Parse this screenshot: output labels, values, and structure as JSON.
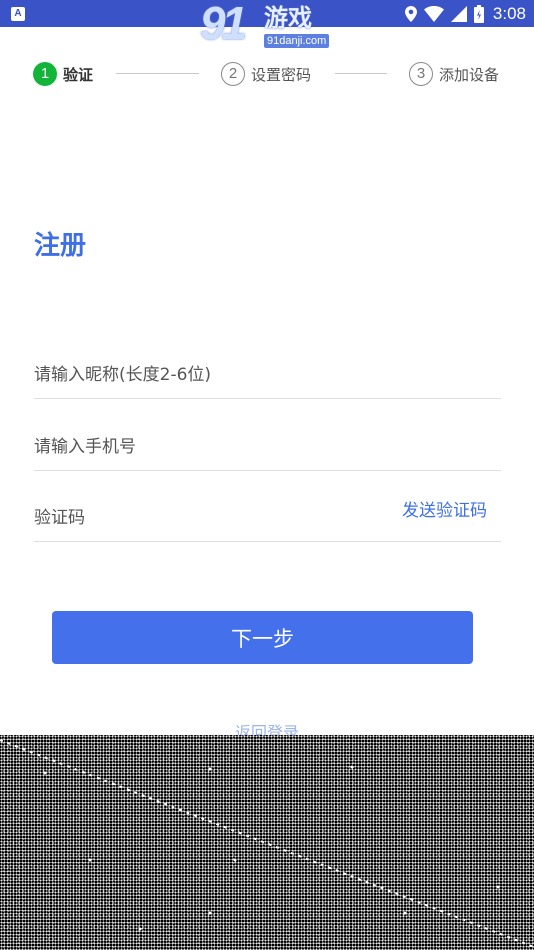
{
  "status_bar": {
    "left_icon": "A",
    "time": "3:08",
    "icons": [
      "location-icon",
      "wifi-icon",
      "signal-icon",
      "battery-icon"
    ]
  },
  "watermark": {
    "digits": "91",
    "name": "游戏",
    "url": "91danji.com"
  },
  "steps": [
    {
      "number": "1",
      "label": "验证",
      "active": true
    },
    {
      "number": "2",
      "label": "设置密码",
      "active": false
    },
    {
      "number": "3",
      "label": "添加设备",
      "active": false
    }
  ],
  "title": "注册",
  "fields": {
    "nickname": {
      "placeholder": "请输入昵称(长度2-6位)",
      "value": ""
    },
    "phone": {
      "placeholder": "请输入手机号",
      "value": ""
    },
    "code": {
      "placeholder": "验证码",
      "value": ""
    }
  },
  "send_code_label": "发送验证码",
  "next_label": "下一步",
  "back_login_label": "返回登录",
  "colors": {
    "status_bar": "#3a53c7",
    "accent": "#3e6fe6",
    "button": "#4470ec",
    "step_active": "#12b43a"
  }
}
